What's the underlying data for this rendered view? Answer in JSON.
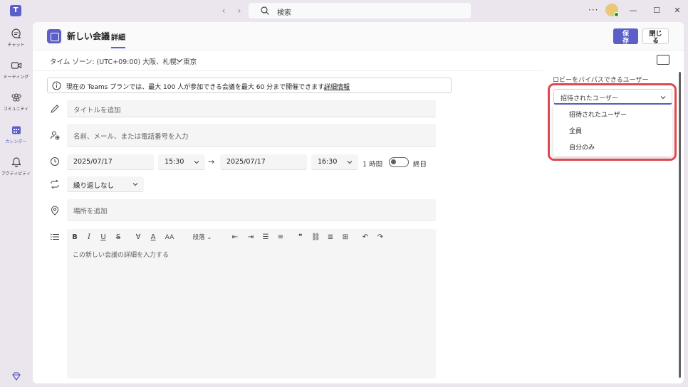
{
  "titlebar": {
    "search_placeholder": "検索",
    "more": "···",
    "minimize": "—",
    "maximize": "☐",
    "close": "✕"
  },
  "rail": {
    "items": [
      {
        "label": "チャット",
        "icon": "chat-icon"
      },
      {
        "label": "ミーティング",
        "icon": "video-icon"
      },
      {
        "label": "コミュニティ",
        "icon": "community-icon"
      },
      {
        "label": "カレンダー",
        "icon": "calendar-icon",
        "active": true
      },
      {
        "label": "アクティビティ",
        "icon": "bell-icon"
      }
    ]
  },
  "header": {
    "title": "新しい会議",
    "tab": "詳細",
    "save_label_1": "保",
    "save_label_2": "存",
    "close_label_1": "閉じ",
    "close_label_2": "る"
  },
  "timezone": "タイム ゾーン: (UTC+09:00) 大阪、札幌、東京",
  "banner": {
    "text": "現在の Teams プランでは、最大 100 人が参加できる会議を最大 60 分まで開催できます。",
    "link": "詳細情報"
  },
  "form": {
    "title_placeholder": "タイトルを追加",
    "attendees_placeholder": "名前、メール、または電話番号を入力",
    "start_date": "2025/07/17",
    "start_time": "15:30",
    "end_date": "2025/07/17",
    "end_time": "16:30",
    "duration": "1 時間",
    "all_day": "終日",
    "repeat": "繰り返しなし",
    "location_placeholder": "場所を追加",
    "details_placeholder": "この新しい会議の詳細を入力する"
  },
  "editor_toolbar": {
    "bold": "B",
    "italic": "I",
    "underline": "U",
    "strike": "S",
    "paragraph": "段落"
  },
  "lobby": {
    "label": "ロビーをバイパスできるユーザー",
    "selected": "招待されたユーザー",
    "options": [
      "招待されたユーザー",
      "全員",
      "自分のみ"
    ]
  },
  "colors": {
    "accent": "#5b5fc7",
    "highlight": "#e0484f"
  }
}
